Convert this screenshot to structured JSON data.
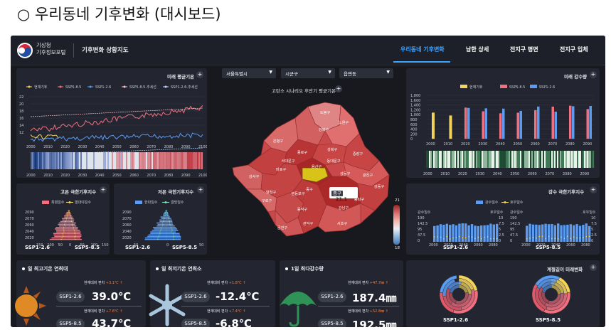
{
  "heading": "○  우리동네  기후변화 (대시보드)",
  "topbar": {
    "org_line1": "기상청",
    "org_line2": "기후정보포털",
    "app_title": "기후변화 상황지도",
    "nav": [
      "우리동네 기후변화",
      "남한 상세",
      "전지구 평면",
      "전지구 입체"
    ]
  },
  "future_temp": {
    "title": "미래 평균기온",
    "legend": [
      "현재기후",
      "SSP5-8.5",
      "SSP1-2.6",
      "SSP5-8.5-추세선",
      "SSP1-2.6-추세선"
    ],
    "y_ticks": [
      "22",
      "20",
      "18",
      "16",
      "14",
      "12"
    ],
    "x_ticks": [
      "2000",
      "2010",
      "2020",
      "2030",
      "2040",
      "2050",
      "2060",
      "2070",
      "2080",
      "2090",
      "2100"
    ],
    "stripe_ticks": [
      "2000",
      "2010",
      "2020",
      "2030",
      "2040",
      "2050",
      "2060",
      "2070",
      "2080",
      "2090",
      "2100"
    ]
  },
  "filters": {
    "region": "서울특별시",
    "district": "시군구",
    "dong": "읍면동"
  },
  "map": {
    "title": "고탄소 시나리오 후반기 평균기온",
    "tooltip_name": "중구",
    "tooltip_value": "21.1",
    "scale_max": "21",
    "scale_min": "18",
    "districts": [
      "도봉구",
      "노원구",
      "강북구",
      "은평구",
      "성북구",
      "종로구",
      "중랑구",
      "서대문구",
      "동대문구",
      "마포구",
      "광진구",
      "강서구",
      "강동구",
      "양천구",
      "영등포구",
      "동작구",
      "송파구",
      "구로구",
      "강남구",
      "금천구",
      "관악구",
      "서초구",
      "성동구",
      "중구",
      "용산구"
    ]
  },
  "heat_extreme": {
    "title": "고온 극한기후지수",
    "legend": [
      "폭염일수",
      "열대야일수"
    ],
    "y_ticks": [
      "2090",
      "2070",
      "2060",
      "2040",
      "2020"
    ],
    "x_ticks": [
      "150",
      "100",
      "50",
      "0",
      "50",
      "100",
      "150"
    ],
    "labels": [
      "SSP1-2.6",
      "SSP5-8.5"
    ]
  },
  "cold_extreme": {
    "title": "저온 극한기후지수",
    "legend": [
      "한파일수",
      "결빙일수"
    ],
    "y_ticks": [
      "2090",
      "2070",
      "2060",
      "2040",
      "2020"
    ],
    "x_ticks": [
      "50",
      "0",
      "50"
    ],
    "labels": [
      "SSP1-2.6",
      "SSP5-8.5"
    ]
  },
  "future_precip": {
    "title": "미래 강수량",
    "legend": [
      "현재기후",
      "SSP5-8.5",
      "SSP1-2.6"
    ],
    "y_ticks": [
      "1,800",
      "1,600",
      "1,400",
      "1,200",
      "1,000",
      "800",
      "600",
      "400",
      "200",
      "0"
    ],
    "x_ticks": [
      "2000",
      "2010",
      "2020",
      "2030",
      "2040",
      "2050",
      "2060",
      "2070",
      "2080",
      "2090"
    ],
    "stripe_ticks": [
      "2000",
      "2010",
      "2020",
      "2030",
      "2040",
      "2050",
      "2060",
      "2070",
      "2080",
      "2090"
    ]
  },
  "precip_extreme": {
    "title": "강수 극한기후지수",
    "legend": [
      "강수일수",
      "호우일수"
    ],
    "left_axis": "강수일수",
    "right_axis": "호우일수",
    "y_ticks_left": [
      "190",
      "142.5",
      "95",
      "47.5",
      "0"
    ],
    "y_ticks_right": [
      "10",
      "7.5",
      "5",
      "2.5",
      "0"
    ],
    "x_ticks": [
      "2000",
      "2020",
      "2040",
      "2060",
      "2080"
    ],
    "labels": [
      "SSP1-2.6",
      "SSP5-8.5"
    ]
  },
  "max_temp": {
    "title": "일 최고기온 연최대",
    "rows": [
      {
        "scenario": "SSP1-2.6",
        "caption": "현재대비 편차",
        "delta": "+3.1℃",
        "value": "39.0℃"
      },
      {
        "scenario": "SSP5-8.5",
        "caption": "현재대비 편차",
        "delta": "+7.8℃",
        "value": "43.7℃"
      }
    ]
  },
  "min_temp": {
    "title": "일 최저기온 연최소",
    "rows": [
      {
        "scenario": "SSP1-2.6",
        "caption": "현재대비 편차",
        "delta": "+1.8℃",
        "value": "-12.4℃"
      },
      {
        "scenario": "SSP5-8.5",
        "caption": "현재대비 편차",
        "delta": "+7.4℃",
        "value": "-6.8℃"
      }
    ]
  },
  "max_precip": {
    "title": "1일 최다강수량",
    "rows": [
      {
        "scenario": "SSP1-2.6",
        "caption": "현재대비 편차",
        "delta": "+47.7㎜",
        "value": "187.4㎜"
      },
      {
        "scenario": "SSP5-8.5",
        "caption": "현재대비 편차",
        "delta": "+52.8㎜",
        "value": "192.5㎜"
      }
    ]
  },
  "seasons": {
    "title": "계절길이 미래변화",
    "labels": [
      "SSP1-2.6",
      "SSP5-8.5"
    ]
  },
  "colors": {
    "accent": "#3ea2ff",
    "ssp585": "#f07080",
    "ssp126": "#5b9bf0",
    "current": "#f2d45c",
    "bg": "#17191f",
    "panel": "#232631"
  }
}
